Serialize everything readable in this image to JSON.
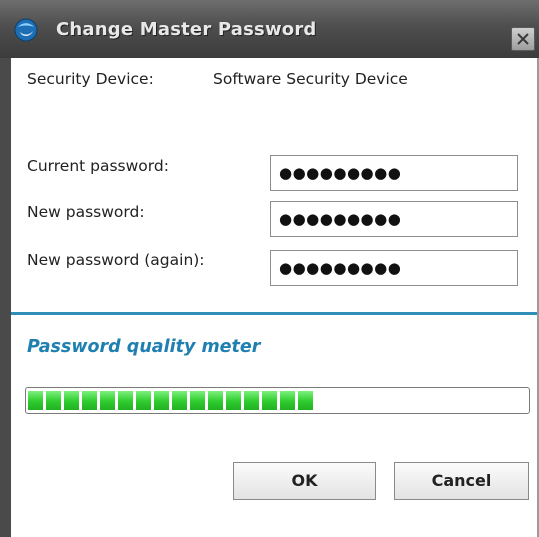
{
  "window": {
    "title": "Change Master Password",
    "close_icon": "close-icon"
  },
  "form": {
    "security_device_label": "Security Device:",
    "security_device_value": "Software Security Device",
    "current_password_label": "Current password:",
    "current_password_value": "●●●●●●●●●",
    "new_password_label": "New password:",
    "new_password_value": "●●●●●●●●●",
    "new_password_again_label": "New password (again):",
    "new_password_again_value": "●●●●●●●●●"
  },
  "meter": {
    "title": "Password quality meter",
    "fill_fraction": 0.6,
    "segments_filled": 16,
    "color": "#2ecc2e"
  },
  "buttons": {
    "ok_label": "OK",
    "cancel_label": "Cancel"
  },
  "colors": {
    "accent": "#1e7fb0",
    "divider": "#2f8fb8",
    "titlebar": "#4e4e4e"
  }
}
